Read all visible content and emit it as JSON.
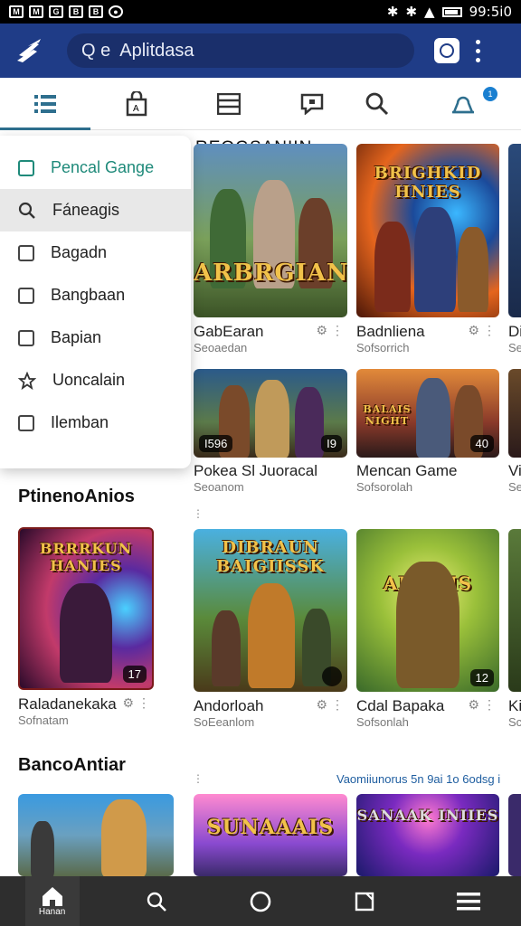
{
  "status_bar": {
    "time": "99:5i0"
  },
  "app_bar": {
    "search_text": "Aplitdasa",
    "search_prefix": "Q e"
  },
  "tabs": [
    {
      "name": "list",
      "icon": "list-icon",
      "active": true
    },
    {
      "name": "store",
      "icon": "shopping-bag-icon",
      "active": false
    },
    {
      "name": "library",
      "icon": "library-icon",
      "active": false
    },
    {
      "name": "messages",
      "icon": "message-icon",
      "active": false
    },
    {
      "name": "search",
      "icon": "search-icon",
      "active": false
    },
    {
      "name": "notifications",
      "icon": "notification-icon",
      "badge": "1",
      "active": false
    }
  ],
  "menu": {
    "items": [
      {
        "label": "Pencal Gange",
        "icon": "square-icon"
      },
      {
        "label": "Fáneagis",
        "icon": "search-icon"
      },
      {
        "label": "Bagadn",
        "icon": "tablet-icon"
      },
      {
        "label": "Bangbaan",
        "icon": "photo-icon"
      },
      {
        "label": "Bapian",
        "icon": "up-arrow-icon"
      },
      {
        "label": "Uoncalain",
        "icon": "star-icon"
      },
      {
        "label": "Ilemban",
        "icon": "window-icon"
      }
    ]
  },
  "grid": {
    "heading": "REOGSANIIN",
    "row1": [
      {
        "title": "GabEaran",
        "sub": "Seoaedan",
        "art": "ARBRGIAN"
      },
      {
        "title": "Badnliena",
        "sub": "Sofsorrich",
        "art": "BRIGHKID HNIES"
      },
      {
        "title": "Di",
        "sub": "Se"
      }
    ],
    "row2": [
      {
        "title": "Pokea Sl Juoracal",
        "sub": "Seoanom",
        "badge_left": "I596",
        "badge_right": "I9"
      },
      {
        "title": "Mencan Game",
        "sub": "Sofsorolah",
        "art": "BALAIS NIGHT",
        "badge_right": "40"
      },
      {
        "title": "Vi",
        "sub": "Se"
      }
    ]
  },
  "popular": {
    "heading": "PtinenoAnios",
    "items": [
      {
        "title": "Raladanekaka",
        "sub": "Sofnatam",
        "art": "BRRRKUN HANIES",
        "badge": "17"
      },
      {
        "title": "Andorloah",
        "sub": "SoEeanlom",
        "art": "DIBRAUN BAIGIISSK",
        "badge": ""
      },
      {
        "title": "Cdal Bapaka",
        "sub": "Sofsonlah",
        "art": "ARHOIS",
        "badge": "12"
      },
      {
        "title": "Ki",
        "sub": "Sc"
      }
    ]
  },
  "recent": {
    "heading": "BancoAntiar",
    "see_more": "Vaomiiunorus 5n 9ai 1o 6odsg i",
    "items": [
      {
        "art": ""
      },
      {
        "art": "SUNAAAIS"
      },
      {
        "art": "SANAAK INIIES"
      }
    ]
  },
  "bottom_nav": [
    {
      "label": "Hanan",
      "icon": "home-icon"
    },
    {
      "label": "",
      "icon": "search-icon"
    },
    {
      "label": "",
      "icon": "circle-icon"
    },
    {
      "label": "",
      "icon": "square-icon"
    },
    {
      "label": "",
      "icon": "menu-icon"
    }
  ],
  "colors": {
    "app_bar": "#1f3c87",
    "menu_accent": "#1f8a7a",
    "badge": "#1a7fd0",
    "bottom_nav": "#2e2e2e"
  }
}
